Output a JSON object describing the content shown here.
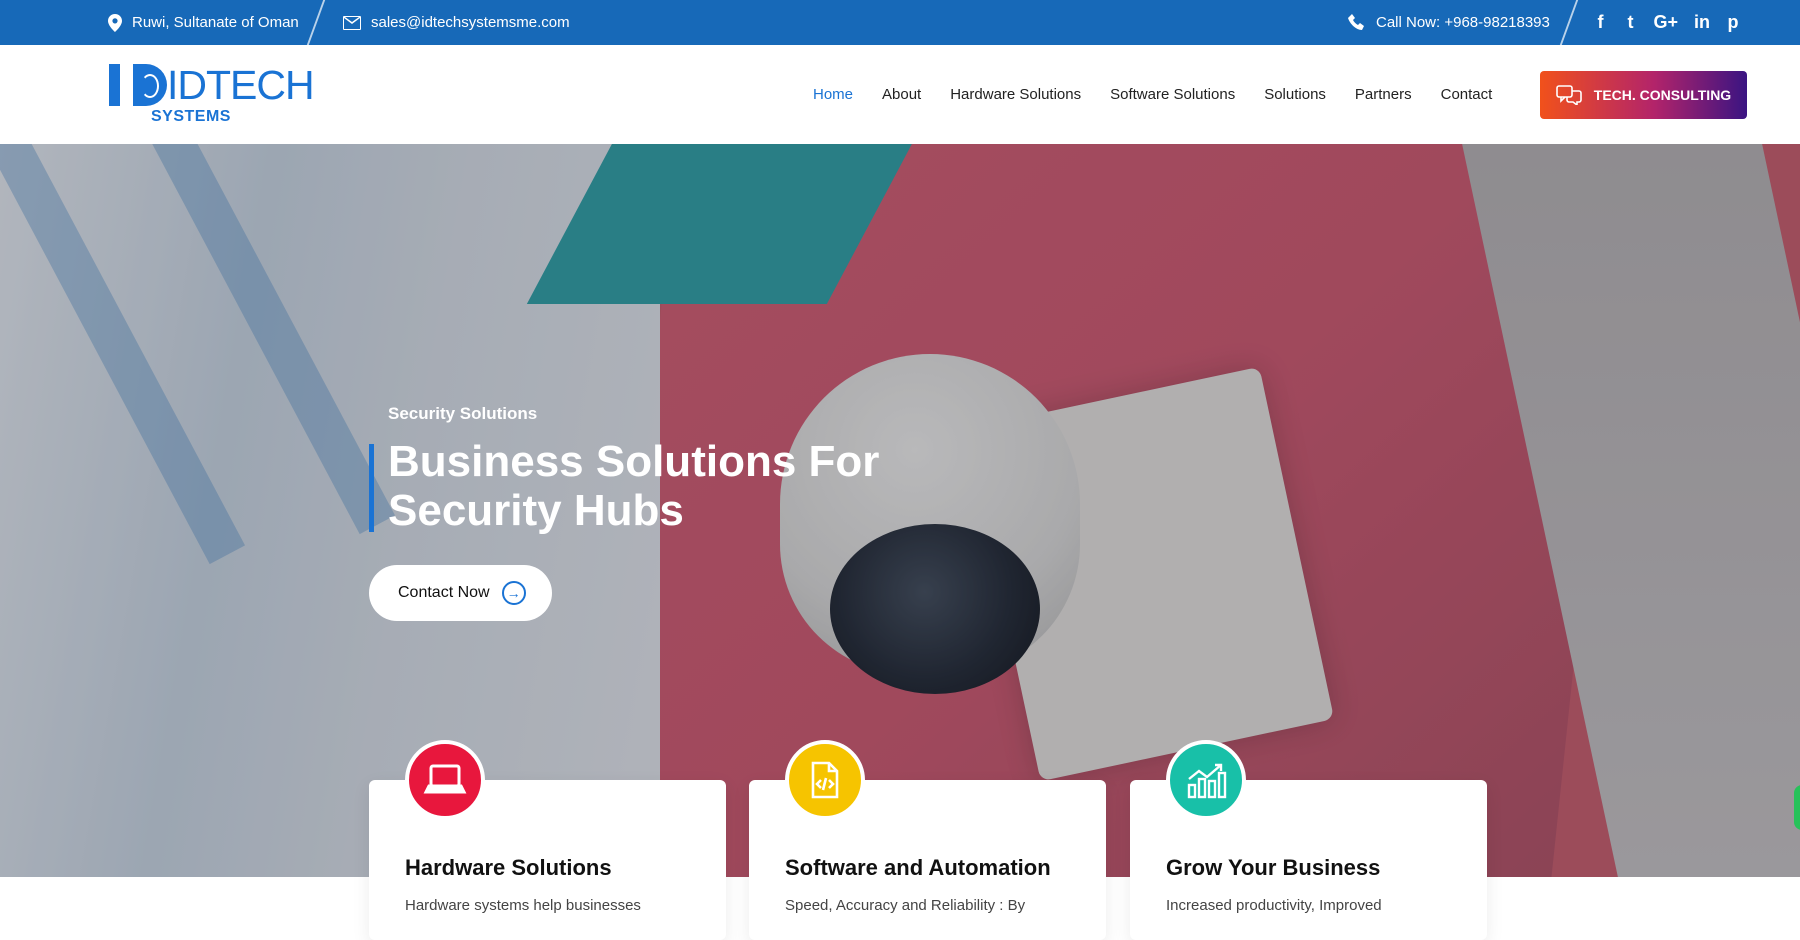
{
  "topbar": {
    "location": "Ruwi, Sultanate of Oman",
    "email": "sales@idtechsystemsme.com",
    "phone": "Call Now: +968-98218393",
    "social": [
      "facebook-icon",
      "twitter-icon",
      "google-plus-icon",
      "linkedin-icon",
      "pinterest-icon"
    ],
    "social_glyphs": [
      "f",
      "t",
      "G+",
      "in",
      "p"
    ]
  },
  "logo": {
    "brand": "IDTECH",
    "tagline": "SYSTEMS"
  },
  "nav": {
    "items": [
      "Home",
      "About",
      "Hardware Solutions",
      "Software Solutions",
      "Solutions",
      "Partners",
      "Contact"
    ],
    "active": "Home",
    "cta_label": "TECH. CONSULTING"
  },
  "hero": {
    "subtitle": "Security Solutions",
    "title": "Business Solutions For Security Hubs",
    "button_label": "Contact Now"
  },
  "cards": [
    {
      "title": "Hardware Solutions",
      "desc": "Hardware systems help businesses",
      "icon": "laptop-icon",
      "color": "#e8173d"
    },
    {
      "title": "Software and Automation",
      "desc": "Speed, Accuracy and Reliability : By",
      "icon": "code-file-icon",
      "color": "#f6c400"
    },
    {
      "title": "Grow Your Business",
      "desc": "Increased productivity, Improved",
      "icon": "chart-growth-icon",
      "color": "#18c0a8"
    }
  ],
  "colors": {
    "primary": "#1769b8",
    "accent": "#1a73d4"
  }
}
